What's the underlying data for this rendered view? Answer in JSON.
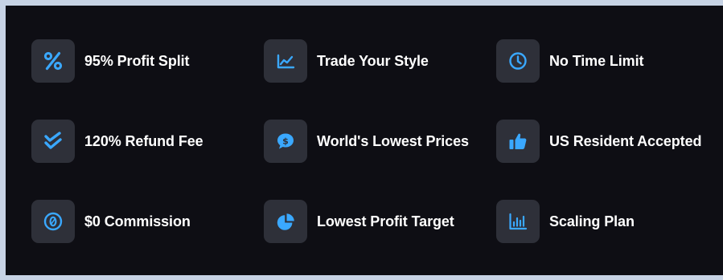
{
  "theme": {
    "accent": "#3aa8ff",
    "tile_bg": "#2e3039",
    "panel_bg": "#0e0e14",
    "page_bg": "#c7d3e5",
    "text": "#ffffff"
  },
  "features": [
    {
      "label": "95% Profit Split",
      "icon": "percent-icon"
    },
    {
      "label": "Trade Your Style",
      "icon": "line-chart-icon"
    },
    {
      "label": "No Time Limit",
      "icon": "clock-icon"
    },
    {
      "label": "120% Refund Fee",
      "icon": "double-check-icon"
    },
    {
      "label": "World's Lowest Prices",
      "icon": "dollar-chat-icon"
    },
    {
      "label": "US Resident Accepted",
      "icon": "thumbs-up-icon"
    },
    {
      "label": "$0 Commission",
      "icon": "zero-circle-icon"
    },
    {
      "label": "Lowest Profit Target",
      "icon": "pie-chart-icon"
    },
    {
      "label": "Scaling Plan",
      "icon": "bar-chart-icon"
    }
  ]
}
